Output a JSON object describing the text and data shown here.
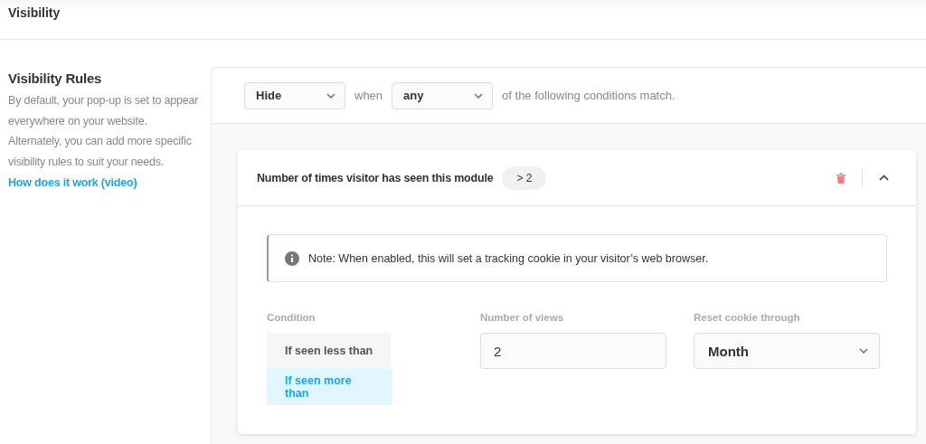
{
  "page_title": "Visibility",
  "sidebar": {
    "heading": "Visibility Rules",
    "description": "By default, your pop-up is set to appear everywhere on your website. Alternately, you can add more specific visibility rules to suit your needs.",
    "link": "How does it work (video)"
  },
  "rule_bar": {
    "action": "Hide",
    "when_label": "when",
    "match": "any",
    "suffix": "of the following conditions match."
  },
  "condition_card": {
    "title": "Number of times visitor has seen this module",
    "badge": "> 2",
    "expanded": true,
    "note": "Note: When enabled, this will set a tracking cookie in your visitor’s web browser.",
    "condition_label": "Condition",
    "conditions": [
      {
        "label": "If seen less than",
        "selected": false
      },
      {
        "label": "If seen more than",
        "selected": true
      }
    ],
    "views_label": "Number of views",
    "views_value": "2",
    "reset_label": "Reset cookie through",
    "reset_value": "Month"
  }
}
